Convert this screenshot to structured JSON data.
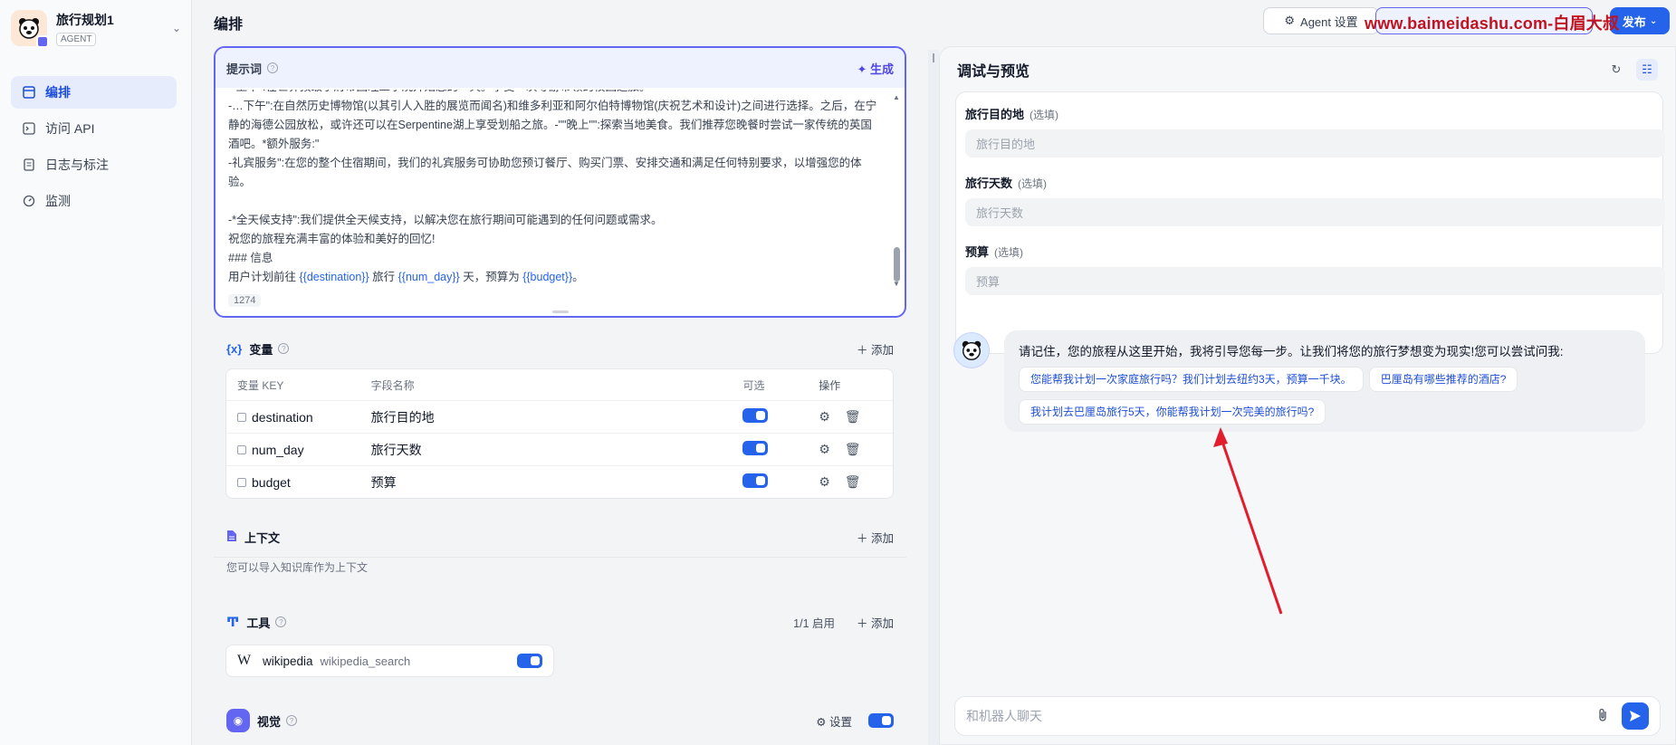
{
  "app": {
    "name": "旅行规划1",
    "tag": "AGENT"
  },
  "nav": [
    {
      "label": "编排",
      "active": true
    },
    {
      "label": "访问 API"
    },
    {
      "label": "日志与标注"
    },
    {
      "label": "监测"
    }
  ],
  "topbar": {
    "title": "编排",
    "agent_settings": "Agent 设置",
    "publish": "发布",
    "watermark": "www.baimeidashu.com-白眉大叔"
  },
  "prompt": {
    "title": "提示词",
    "generate": "生成",
    "lines": [
      "-\"上午\":在世界顶级学府帝国理工学院开始您的一天。享受一次导游带领的校园之旅。",
      "-…下午\":在自然历史博物馆(以其引人入胜的展览而闻名)和维多利亚和阿尔伯特博物馆(庆祝艺术和设计)之间进行选择。之后，在宁静的海德公园放松，或许还可以在Serpentine湖上享受划船之旅。-\"\"晚上\"\":探索当地美食。我们推荐您晚餐时尝试一家传统的英国酒吧。*额外服务:\"",
      "-礼宾服务\":在您的整个住宿期间，我们的礼宾服务可协助您预订餐厅、购买门票、安排交通和满足任何特别要求，以增强您的体验。",
      "",
      "-*全天候支持\":我们提供全天候支持，以解决您在旅行期间可能遇到的任何问题或需求。",
      "祝您的旅程充满丰富的体验和美好的回忆!",
      "### 信息"
    ],
    "last_line_prefix": "用户计划前往 ",
    "var_destination": "{{destination}}",
    "last_line_mid1": " 旅行 ",
    "var_num_day": "{{num_day}}",
    "last_line_mid2": " 天，预算为 ",
    "var_budget": "{{budget}}",
    "last_line_suffix": "。",
    "char_count": "1274"
  },
  "variables": {
    "title": "变量",
    "add": "添加",
    "columns": [
      "变量 KEY",
      "字段名称",
      "可选",
      "操作"
    ],
    "rows": [
      {
        "key": "destination",
        "name": "旅行目的地"
      },
      {
        "key": "num_day",
        "name": "旅行天数"
      },
      {
        "key": "budget",
        "name": "预算"
      }
    ]
  },
  "context": {
    "title": "上下文",
    "add": "添加",
    "desc": "您可以导入知识库作为上下文"
  },
  "tools": {
    "title": "工具",
    "enabled_count": "1/1 启用",
    "add": "添加",
    "items": [
      {
        "name": "wikipedia",
        "id": "wikipedia_search"
      }
    ]
  },
  "vision": {
    "title": "视觉",
    "settings": "设置"
  },
  "preview": {
    "title": "调试与预览",
    "fields": [
      {
        "label": "旅行目的地",
        "optional": "(选填)",
        "placeholder": "旅行目的地"
      },
      {
        "label": "旅行天数",
        "optional": "(选填)",
        "placeholder": "旅行天数"
      },
      {
        "label": "预算",
        "optional": "(选填)",
        "placeholder": "预算"
      }
    ],
    "opening": "请记住，您的旅程从这里开始，我将引导您每一步。让我们将您的旅行梦想变为现实!您可以尝试问我:",
    "suggestions": [
      "您能帮我计划一次家庭旅行吗？我们计划去纽约3天，预算一千块。",
      "巴厘岛有哪些推荐的酒店?",
      "我计划去巴厘岛旅行5天，你能帮我计划一次完美的旅行吗?"
    ],
    "chat_placeholder": "和机器人聊天"
  },
  "colors": {
    "accent": "#2563eb",
    "indigo": "#6366f1",
    "annotation_arrow": "#e11d2e"
  }
}
